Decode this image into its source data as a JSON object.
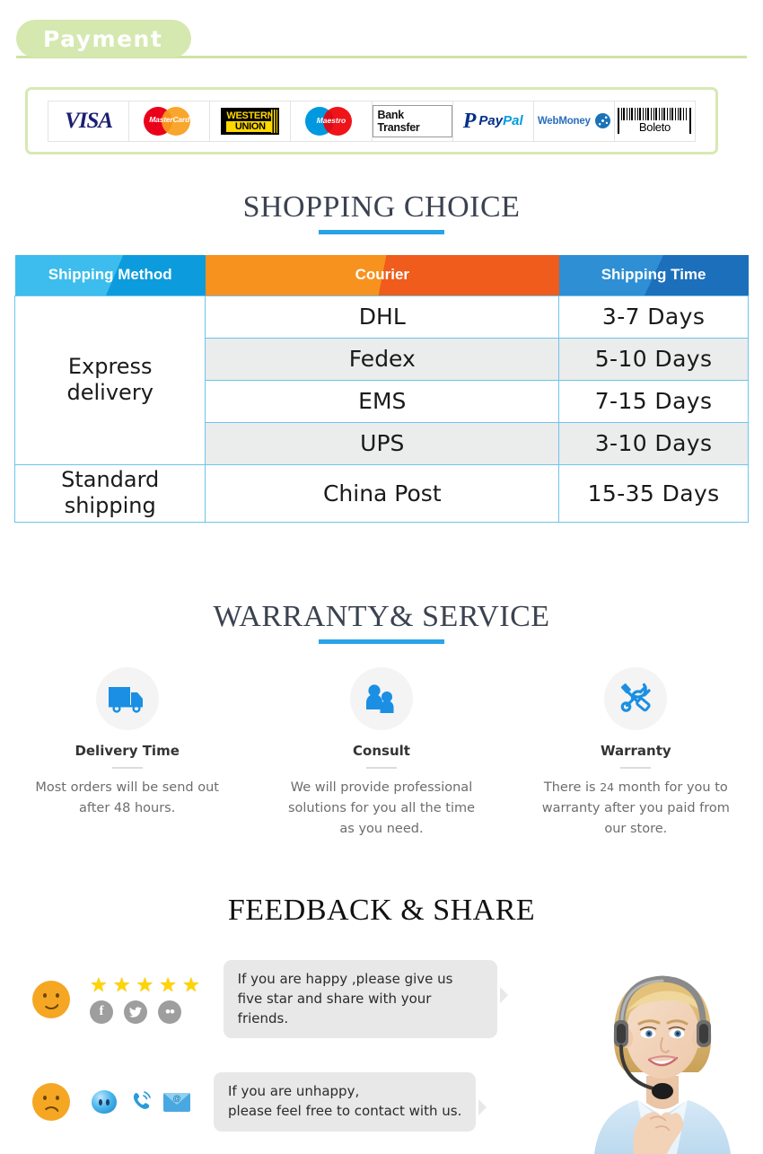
{
  "payment": {
    "badge_label": "Payment",
    "methods": [
      {
        "name": "visa",
        "label": "VISA"
      },
      {
        "name": "mastercard",
        "label": "MasterCard"
      },
      {
        "name": "western-union",
        "label_top": "WESTERN",
        "label_bottom": "UNION"
      },
      {
        "name": "maestro",
        "label": "Maestro"
      },
      {
        "name": "bank-transfer",
        "label": "Bank Transfer"
      },
      {
        "name": "paypal",
        "label_1": "Pay",
        "label_2": "Pal",
        "glyph": "P"
      },
      {
        "name": "webmoney",
        "label": "WebMoney"
      },
      {
        "name": "boleto",
        "label": "Boleto"
      }
    ]
  },
  "shopping_choice": {
    "title": "SHOPPING CHOICE",
    "columns": [
      "Shipping Method",
      "Courier",
      "Shipping Time"
    ],
    "rows": [
      {
        "method": "Express delivery",
        "method_line1": "Express",
        "method_line2": "delivery",
        "courier": "DHL",
        "time": "3-7  Days"
      },
      {
        "courier": "Fedex",
        "time": "5-10 Days"
      },
      {
        "courier": "EMS",
        "time": "7-15 Days"
      },
      {
        "courier": "UPS",
        "time": "3-10 Days"
      },
      {
        "method_line1": "Standard",
        "method_line2": "shipping",
        "courier": "China Post",
        "time": "15-35 Days"
      }
    ]
  },
  "warranty": {
    "title": "WARRANTY& SERVICE",
    "items": [
      {
        "icon": "truck-icon",
        "name": "Delivery Time",
        "desc_line1": "Most orders will be send out",
        "desc_line2": "after 48 hours."
      },
      {
        "icon": "people-icon",
        "name": "Consult",
        "desc_line1": "We will provide professional",
        "desc_line2": "solutions for you all the time",
        "desc_line3": "as you need."
      },
      {
        "icon": "tools-icon",
        "name": "Warranty",
        "desc_prefix": "There is",
        "desc_number": "24",
        "desc_suffix": "month for you to",
        "desc_line2": "warranty after you paid from",
        "desc_line3": "our store."
      }
    ]
  },
  "feedback": {
    "title": "FEEDBACK & SHARE",
    "happy": {
      "face": "smiley-face",
      "star_count": 5,
      "star_glyph": "★",
      "socials": [
        {
          "name": "facebook",
          "glyph": "f"
        },
        {
          "name": "twitter",
          "glyph": "ᵥ"
        },
        {
          "name": "flickr",
          "glyph": "••"
        }
      ],
      "message_line1": "If you are happy ,please give us",
      "message_line2": "five star and share with your friends."
    },
    "unhappy": {
      "face": "sad-face",
      "icons": [
        "messenger-icon",
        "phone-icon",
        "email-icon"
      ],
      "message_line1": "If you are unhappy,",
      "message_line2": "please feel free to contact with us."
    },
    "agent_photo": "customer-service-agent-photo"
  },
  "colors": {
    "badge_green": "#d5e8b0",
    "rule_green": "#cfe3a5",
    "accent_blue": "#29a3e8",
    "header_orange": "#f7921e",
    "table_border": "#6ec4ea",
    "icon_blue": "#1a8fe3",
    "face_orange": "#f5a623",
    "star_yellow": "#ffd400"
  }
}
